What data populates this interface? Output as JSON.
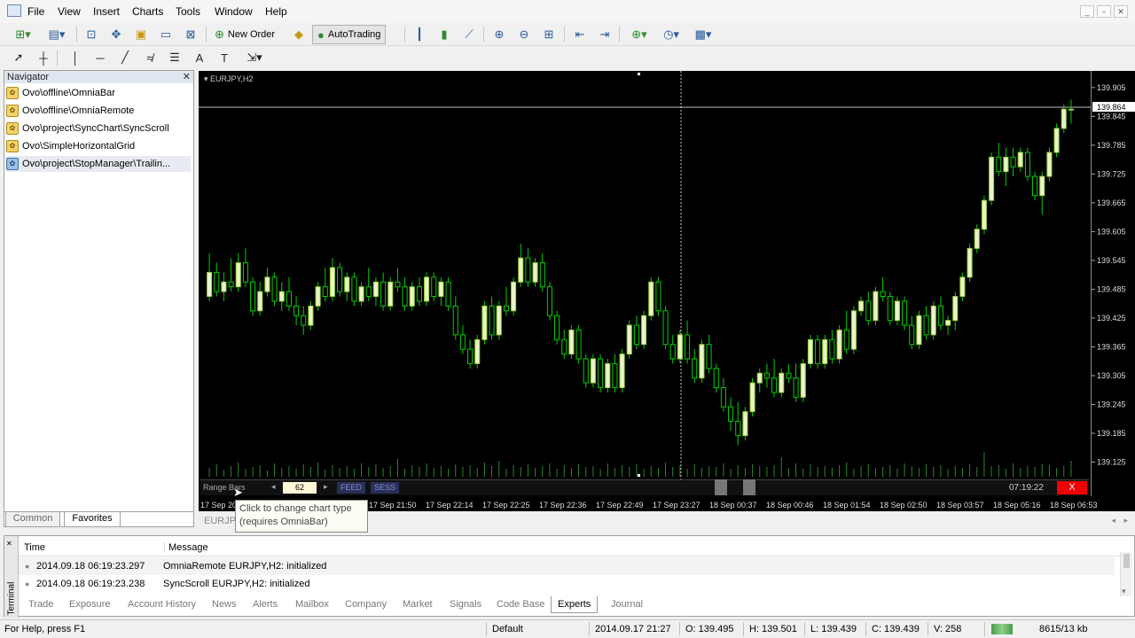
{
  "menubar": {
    "items": [
      "File",
      "View",
      "Insert",
      "Charts",
      "Tools",
      "Window",
      "Help"
    ],
    "controls": [
      "_",
      "▫",
      "✕"
    ]
  },
  "toolbar": {
    "new_order_label": "New Order",
    "autotrading_label": "AutoTrading"
  },
  "navigator": {
    "title": "Navigator",
    "items": [
      "Ovo\\offline\\OmniaBar",
      "Ovo\\offline\\OmniaRemote",
      "Ovo\\project\\SyncChart\\SyncScroll",
      "Ovo\\SimpleHorizontalGrid",
      "Ovo\\project\\StopManager\\Trailin..."
    ],
    "tabs": [
      "Common",
      "Favorites"
    ]
  },
  "chart": {
    "title": "EURJPY,H2",
    "current_price": "139.864",
    "price_labels": [
      "139.905",
      "139.845",
      "139.785",
      "139.725",
      "139.665",
      "139.605",
      "139.545",
      "139.485",
      "139.425",
      "139.365",
      "139.305",
      "139.245",
      "139.185",
      "139.125"
    ],
    "time_labels": [
      "17 Sep 20",
      "17 Sep 21:50",
      "17 Sep 22:14",
      "17 Sep 22:25",
      "17 Sep 22:36",
      "17 Sep 22:49",
      "17 Sep 23:27",
      "18 Sep 00:37",
      "18 Sep 00:46",
      "18 Sep 01:54",
      "18 Sep 02:50",
      "18 Sep 03:57",
      "18 Sep 05:16",
      "18 Sep 06:53"
    ],
    "tab_label": "EURJP"
  },
  "omnia_bar": {
    "range_label": "Range Bars",
    "range_value": "62",
    "feed_label": "FEED",
    "sess_label": "SESS",
    "timer": "07:19:22",
    "close_label": "X"
  },
  "tooltip": {
    "line1": "Click to change chart type",
    "line2": "(requires OmniaBar)"
  },
  "terminal": {
    "side_label": "Terminal",
    "columns": [
      "Time",
      "Message"
    ],
    "rows": [
      {
        "time": "2014.09.18 06:19:23.297",
        "message": "OmniaRemote EURJPY,H2: initialized"
      },
      {
        "time": "2014.09.18 06:19:23.238",
        "message": "SyncScroll EURJPY,H2: initialized"
      }
    ],
    "tabs": [
      "Trade",
      "Exposure",
      "Account History",
      "News",
      "Alerts",
      "Mailbox",
      "Company",
      "Market",
      "Signals",
      "Code Base",
      "Experts",
      "Journal"
    ],
    "active_tab": "Experts"
  },
  "statusbar": {
    "help": "For Help, press F1",
    "profile": "Default",
    "datetime": "2014.09.17 21:27",
    "open": "O: 139.495",
    "high": "H: 139.501",
    "low": "L: 139.439",
    "close": "C: 139.439",
    "volume": "V: 258",
    "traffic": "8615/13 kb"
  },
  "candles": [
    [
      139.47,
      139.56,
      139.46,
      139.52
    ],
    [
      139.52,
      139.54,
      139.47,
      139.48
    ],
    [
      139.48,
      139.52,
      139.46,
      139.5
    ],
    [
      139.5,
      139.55,
      139.48,
      139.49
    ],
    [
      139.49,
      139.56,
      139.48,
      139.54
    ],
    [
      139.54,
      139.57,
      139.49,
      139.5
    ],
    [
      139.5,
      139.51,
      139.43,
      139.44
    ],
    [
      139.44,
      139.5,
      139.43,
      139.48
    ],
    [
      139.48,
      139.53,
      139.47,
      139.51
    ],
    [
      139.51,
      139.52,
      139.45,
      139.46
    ],
    [
      139.46,
      139.5,
      139.44,
      139.48
    ],
    [
      139.48,
      139.51,
      139.44,
      139.45
    ],
    [
      139.45,
      139.47,
      139.41,
      139.43
    ],
    [
      139.43,
      139.45,
      139.39,
      139.41
    ],
    [
      139.41,
      139.46,
      139.4,
      139.45
    ],
    [
      139.45,
      139.5,
      139.44,
      139.49
    ],
    [
      139.49,
      139.53,
      139.46,
      139.47
    ],
    [
      139.47,
      139.55,
      139.46,
      139.53
    ],
    [
      139.53,
      139.54,
      139.47,
      139.48
    ],
    [
      139.48,
      139.52,
      139.46,
      139.51
    ],
    [
      139.51,
      139.52,
      139.45,
      139.46
    ],
    [
      139.46,
      139.5,
      139.45,
      139.49
    ],
    [
      139.49,
      139.53,
      139.46,
      139.47
    ],
    [
      139.47,
      139.51,
      139.45,
      139.5
    ],
    [
      139.5,
      139.52,
      139.44,
      139.45
    ],
    [
      139.45,
      139.51,
      139.44,
      139.5
    ],
    [
      139.5,
      139.53,
      139.48,
      139.49
    ],
    [
      139.49,
      139.51,
      139.44,
      139.45
    ],
    [
      139.45,
      139.5,
      139.44,
      139.49
    ],
    [
      139.49,
      139.51,
      139.45,
      139.46
    ],
    [
      139.46,
      139.52,
      139.45,
      139.51
    ],
    [
      139.51,
      139.52,
      139.46,
      139.47
    ],
    [
      139.47,
      139.51,
      139.45,
      139.5
    ],
    [
      139.5,
      139.51,
      139.44,
      139.45
    ],
    [
      139.45,
      139.47,
      139.38,
      139.39
    ],
    [
      139.39,
      139.41,
      139.35,
      139.36
    ],
    [
      139.36,
      139.38,
      139.32,
      139.33
    ],
    [
      139.33,
      139.39,
      139.32,
      139.38
    ],
    [
      139.38,
      139.46,
      139.37,
      139.45
    ],
    [
      139.45,
      139.47,
      139.38,
      139.39
    ],
    [
      139.39,
      139.46,
      139.38,
      139.45
    ],
    [
      139.45,
      139.49,
      139.43,
      139.44
    ],
    [
      139.44,
      139.51,
      139.43,
      139.5
    ],
    [
      139.5,
      139.58,
      139.49,
      139.55
    ],
    [
      139.55,
      139.57,
      139.49,
      139.5
    ],
    [
      139.5,
      139.55,
      139.49,
      139.54
    ],
    [
      139.54,
      139.56,
      139.48,
      139.49
    ],
    [
      139.49,
      139.5,
      139.42,
      139.43
    ],
    [
      139.43,
      139.44,
      139.37,
      139.38
    ],
    [
      139.38,
      139.4,
      139.34,
      139.35
    ],
    [
      139.35,
      139.41,
      139.34,
      139.4
    ],
    [
      139.4,
      139.41,
      139.33,
      139.34
    ],
    [
      139.34,
      139.35,
      139.28,
      139.29
    ],
    [
      139.29,
      139.35,
      139.28,
      139.34
    ],
    [
      139.34,
      139.35,
      139.27,
      139.28
    ],
    [
      139.28,
      139.34,
      139.27,
      139.33
    ],
    [
      139.33,
      139.35,
      139.27,
      139.28
    ],
    [
      139.28,
      139.36,
      139.27,
      139.35
    ],
    [
      139.35,
      139.42,
      139.34,
      139.41
    ],
    [
      139.41,
      139.43,
      139.36,
      139.37
    ],
    [
      139.37,
      139.44,
      139.36,
      139.43
    ],
    [
      139.43,
      139.51,
      139.42,
      139.5
    ],
    [
      139.5,
      139.51,
      139.43,
      139.44
    ],
    [
      139.44,
      139.45,
      139.36,
      139.37
    ],
    [
      139.37,
      139.39,
      139.33,
      139.34
    ],
    [
      139.34,
      139.4,
      139.33,
      139.39
    ],
    [
      139.39,
      139.42,
      139.33,
      139.34
    ],
    [
      139.34,
      139.36,
      139.29,
      139.3
    ],
    [
      139.3,
      139.38,
      139.29,
      139.37
    ],
    [
      139.37,
      139.39,
      139.31,
      139.32
    ],
    [
      139.32,
      139.33,
      139.27,
      139.28
    ],
    [
      139.28,
      139.3,
      139.23,
      139.24
    ],
    [
      139.24,
      139.26,
      139.19,
      139.21
    ],
    [
      139.21,
      139.25,
      139.16,
      139.18
    ],
    [
      139.18,
      139.24,
      139.17,
      139.23
    ],
    [
      139.23,
      139.3,
      139.22,
      139.29
    ],
    [
      139.29,
      139.32,
      139.27,
      139.31
    ],
    [
      139.31,
      139.33,
      139.28,
      139.3
    ],
    [
      139.3,
      139.34,
      139.26,
      139.27
    ],
    [
      139.27,
      139.32,
      139.26,
      139.31
    ],
    [
      139.31,
      139.33,
      139.29,
      139.3
    ],
    [
      139.3,
      139.33,
      139.25,
      139.26
    ],
    [
      139.26,
      139.34,
      139.25,
      139.33
    ],
    [
      139.33,
      139.39,
      139.32,
      139.38
    ],
    [
      139.38,
      139.39,
      139.32,
      139.33
    ],
    [
      139.33,
      139.39,
      139.32,
      139.38
    ],
    [
      139.38,
      139.4,
      139.33,
      139.34
    ],
    [
      139.34,
      139.41,
      139.33,
      139.4
    ],
    [
      139.4,
      139.44,
      139.35,
      139.36
    ],
    [
      139.36,
      139.45,
      139.35,
      139.44
    ],
    [
      139.44,
      139.47,
      139.43,
      139.46
    ],
    [
      139.46,
      139.48,
      139.41,
      139.42
    ],
    [
      139.42,
      139.49,
      139.41,
      139.48
    ],
    [
      139.48,
      139.51,
      139.46,
      139.47
    ],
    [
      139.47,
      139.48,
      139.41,
      139.42
    ],
    [
      139.42,
      139.47,
      139.41,
      139.46
    ],
    [
      139.46,
      139.47,
      139.4,
      139.41
    ],
    [
      139.41,
      139.43,
      139.36,
      139.37
    ],
    [
      139.37,
      139.44,
      139.36,
      139.43
    ],
    [
      139.43,
      139.45,
      139.38,
      139.39
    ],
    [
      139.39,
      139.46,
      139.38,
      139.45
    ],
    [
      139.45,
      139.47,
      139.4,
      139.41
    ],
    [
      139.41,
      139.43,
      139.39,
      139.42
    ],
    [
      139.42,
      139.48,
      139.4,
      139.47
    ],
    [
      139.47,
      139.52,
      139.46,
      139.51
    ],
    [
      139.51,
      139.58,
      139.5,
      139.57
    ],
    [
      139.57,
      139.62,
      139.56,
      139.61
    ],
    [
      139.61,
      139.68,
      139.6,
      139.67
    ],
    [
      139.67,
      139.77,
      139.66,
      139.76
    ],
    [
      139.76,
      139.79,
      139.72,
      139.73
    ],
    [
      139.73,
      139.78,
      139.7,
      139.76
    ],
    [
      139.76,
      139.78,
      139.72,
      139.74
    ],
    [
      139.74,
      139.78,
      139.73,
      139.77
    ],
    [
      139.77,
      139.78,
      139.71,
      139.72
    ],
    [
      139.72,
      139.73,
      139.67,
      139.68
    ],
    [
      139.68,
      139.73,
      139.64,
      139.72
    ],
    [
      139.72,
      139.78,
      139.71,
      139.77
    ],
    [
      139.77,
      139.83,
      139.76,
      139.82
    ],
    [
      139.82,
      139.87,
      139.81,
      139.86
    ],
    [
      139.86,
      139.88,
      139.83,
      139.86
    ]
  ],
  "volumes": [
    10,
    14,
    8,
    12,
    16,
    9,
    11,
    13,
    7,
    15,
    10,
    12,
    9,
    14,
    11,
    16,
    8,
    13,
    10,
    12,
    9,
    15,
    11,
    14,
    10,
    12,
    20,
    9,
    13,
    11,
    15,
    10,
    12,
    9,
    14,
    11,
    13,
    10,
    16,
    12,
    18,
    9,
    13,
    11,
    14,
    10,
    12,
    15,
    9,
    13,
    10,
    14,
    11,
    12,
    9,
    15,
    10,
    13,
    11,
    14,
    9,
    12,
    10,
    16,
    11,
    13,
    9,
    14,
    10,
    12,
    11,
    15,
    9,
    13,
    10,
    14,
    12,
    11,
    13,
    22,
    10,
    15,
    9,
    14,
    11,
    12,
    10,
    13,
    16,
    9,
    12,
    14,
    10,
    11,
    13,
    9,
    15,
    12,
    10,
    14,
    11,
    13,
    9,
    12,
    10,
    14,
    11,
    28,
    12,
    13,
    9,
    15,
    10,
    12,
    11,
    14,
    13,
    10,
    12,
    18
  ]
}
